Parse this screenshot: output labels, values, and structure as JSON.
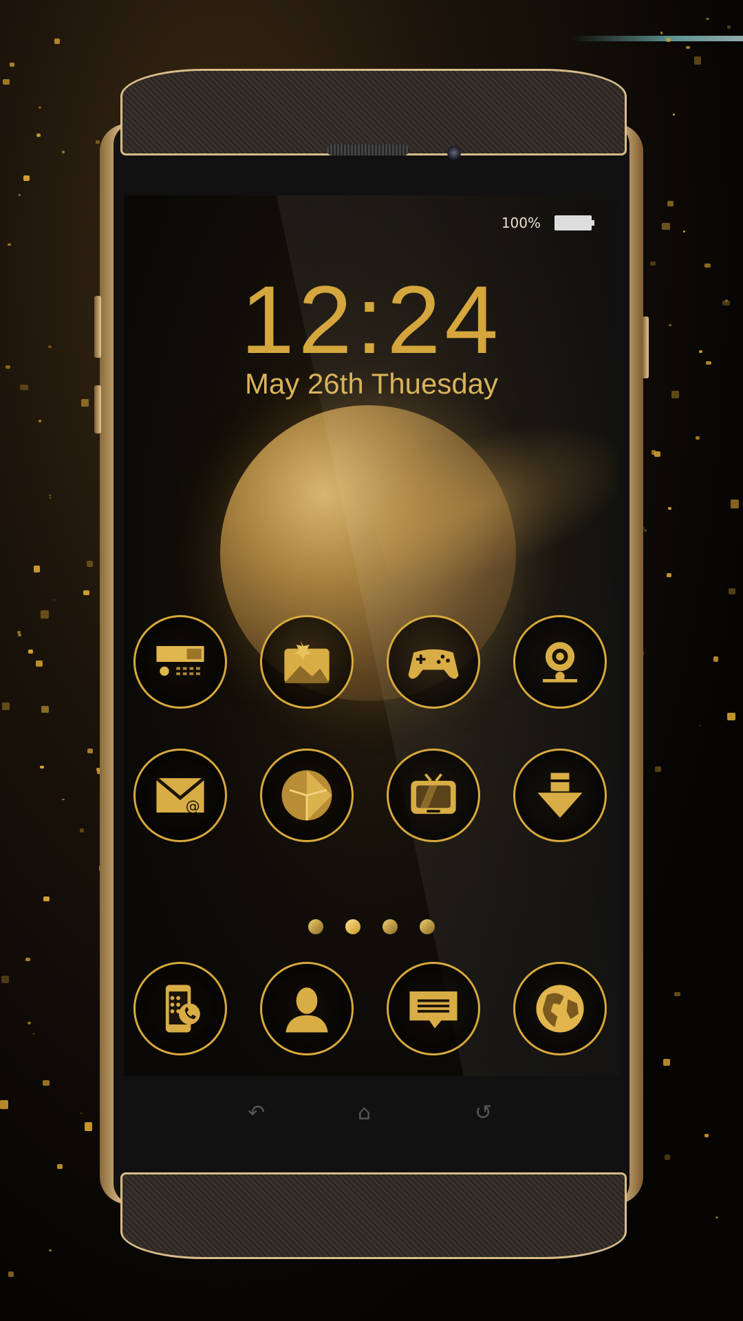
{
  "status_bar": {
    "battery_percent": "100%",
    "battery_level": 1.0
  },
  "lockscreen": {
    "time": "12:24",
    "date": "May 26th Thuesday"
  },
  "home": {
    "apps_row1": [
      {
        "icon": "calculator-icon"
      },
      {
        "icon": "gallery-icon"
      },
      {
        "icon": "game-controller-icon"
      },
      {
        "icon": "camera-icon"
      }
    ],
    "apps_row2": [
      {
        "icon": "email-icon"
      },
      {
        "icon": "clock-icon"
      },
      {
        "icon": "tv-icon"
      },
      {
        "icon": "download-icon"
      }
    ],
    "page_indicator": {
      "pages": 4,
      "current": 2
    },
    "dock": [
      {
        "icon": "phone-dialer-icon"
      },
      {
        "icon": "contacts-icon"
      },
      {
        "icon": "messages-icon"
      },
      {
        "icon": "browser-globe-icon"
      }
    ]
  },
  "colors": {
    "gold": "#d8a93c",
    "gold_light": "#f0cf6d",
    "background": "#0a0907"
  }
}
